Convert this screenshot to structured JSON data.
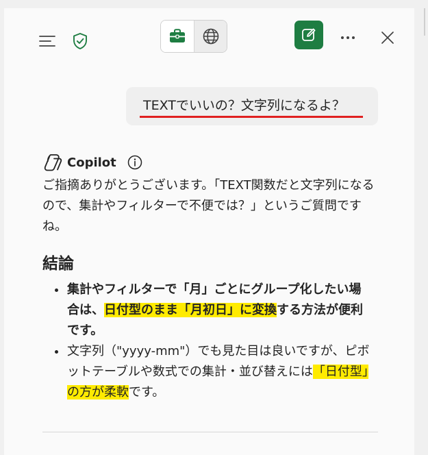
{
  "header": {
    "menu_icon": "hamburger-menu-icon",
    "shield_icon": "shield-check-icon",
    "mode_work_icon": "briefcase-icon",
    "mode_web_icon": "globe-icon",
    "new_chat_icon": "compose-icon",
    "more_icon": "more-horizontal-icon",
    "close_icon": "close-icon",
    "accent_color": "#1e7d42"
  },
  "user_message": {
    "text": "TEXTでいいの？文字列になるよ？",
    "underline_color": "#e02020"
  },
  "assistant": {
    "name": "Copilot",
    "info_icon": "info-icon",
    "intro": "ご指摘ありがとうございます。「TEXT関数だと文字列になるので、集計やフィルターで不便では？」というご質問ですね。",
    "heading": "結論",
    "bullets": [
      {
        "part1": "集計やフィルターで「月」ごとにグループ化したい場合は、",
        "highlight": "日付型のまま「月初日」に変換",
        "part2": "する方法が便利です。"
      },
      {
        "part1": "文字列（\"yyyy-mm\"）でも見た目は良いですが、ピボットテーブルや数式での集計・並び替えには",
        "highlight": "「日付型」の方が柔軟",
        "part2": "です。"
      }
    ],
    "highlight_color": "#ffeb00"
  }
}
